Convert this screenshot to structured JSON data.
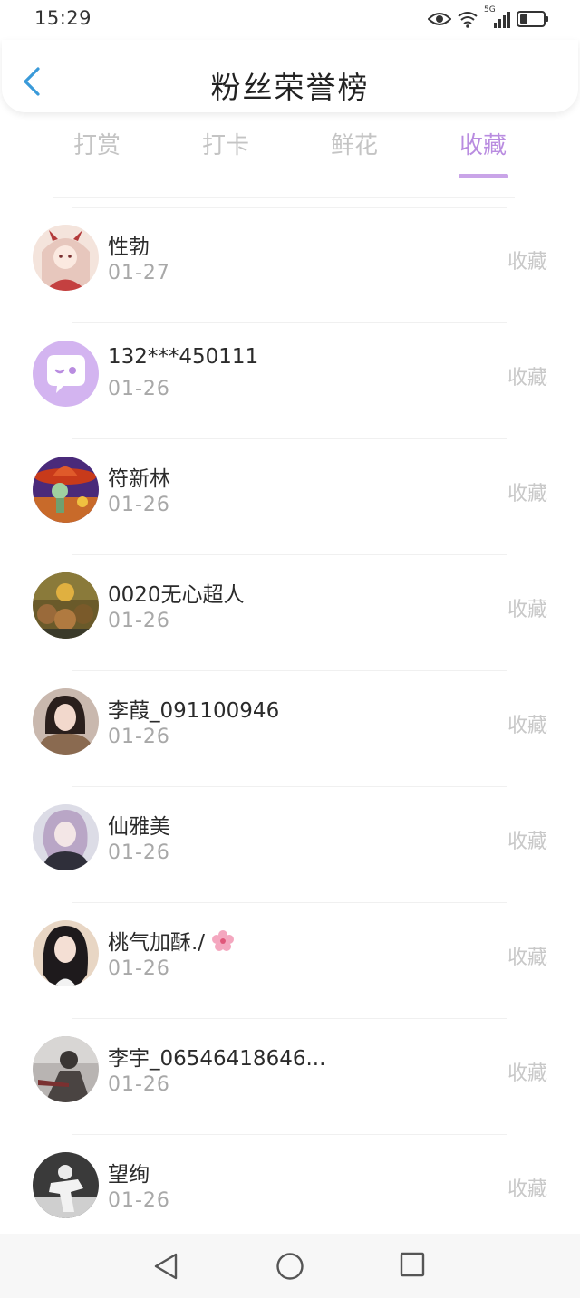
{
  "status_bar": {
    "time": "15:29",
    "signal_label": "5G"
  },
  "header": {
    "title": "粉丝荣誉榜"
  },
  "tabs": [
    {
      "label": "打赏",
      "active": false
    },
    {
      "label": "打卡",
      "active": false
    },
    {
      "label": "鲜花",
      "active": false
    },
    {
      "label": "收藏",
      "active": true
    }
  ],
  "colors": {
    "accent": "#b98ce0",
    "tab_inactive": "#c4c4c4",
    "back_arrow": "#3a9ad9"
  },
  "list": {
    "items": [
      {
        "name": "性勃",
        "date": "01-27",
        "action": "收藏",
        "avatar": "anime-girl-avatar"
      },
      {
        "name": "132***450111",
        "date": "01-26",
        "action": "收藏",
        "avatar": "default-chat-avatar"
      },
      {
        "name": "符新林",
        "date": "01-26",
        "action": "收藏",
        "avatar": "sombrero-cartoon-avatar"
      },
      {
        "name": "0020无心超人",
        "date": "01-26",
        "action": "收藏",
        "avatar": "characters-group-avatar"
      },
      {
        "name": "李葭_091100946",
        "date": "01-26",
        "action": "收藏",
        "avatar": "woman-fur-coat-avatar"
      },
      {
        "name": "仙雅美",
        "date": "01-26",
        "action": "收藏",
        "avatar": "girl-selfie-avatar"
      },
      {
        "name": "桃气加酥./",
        "date": "01-26",
        "action": "收藏",
        "avatar": "girl-dark-hair-avatar"
      },
      {
        "name": "李宇_06546418646...",
        "date": "01-26",
        "action": "收藏",
        "avatar": "person-grayscale-avatar"
      },
      {
        "name": "望绚",
        "date": "01-26",
        "action": "收藏",
        "avatar": "dancer-bw-avatar"
      }
    ]
  }
}
